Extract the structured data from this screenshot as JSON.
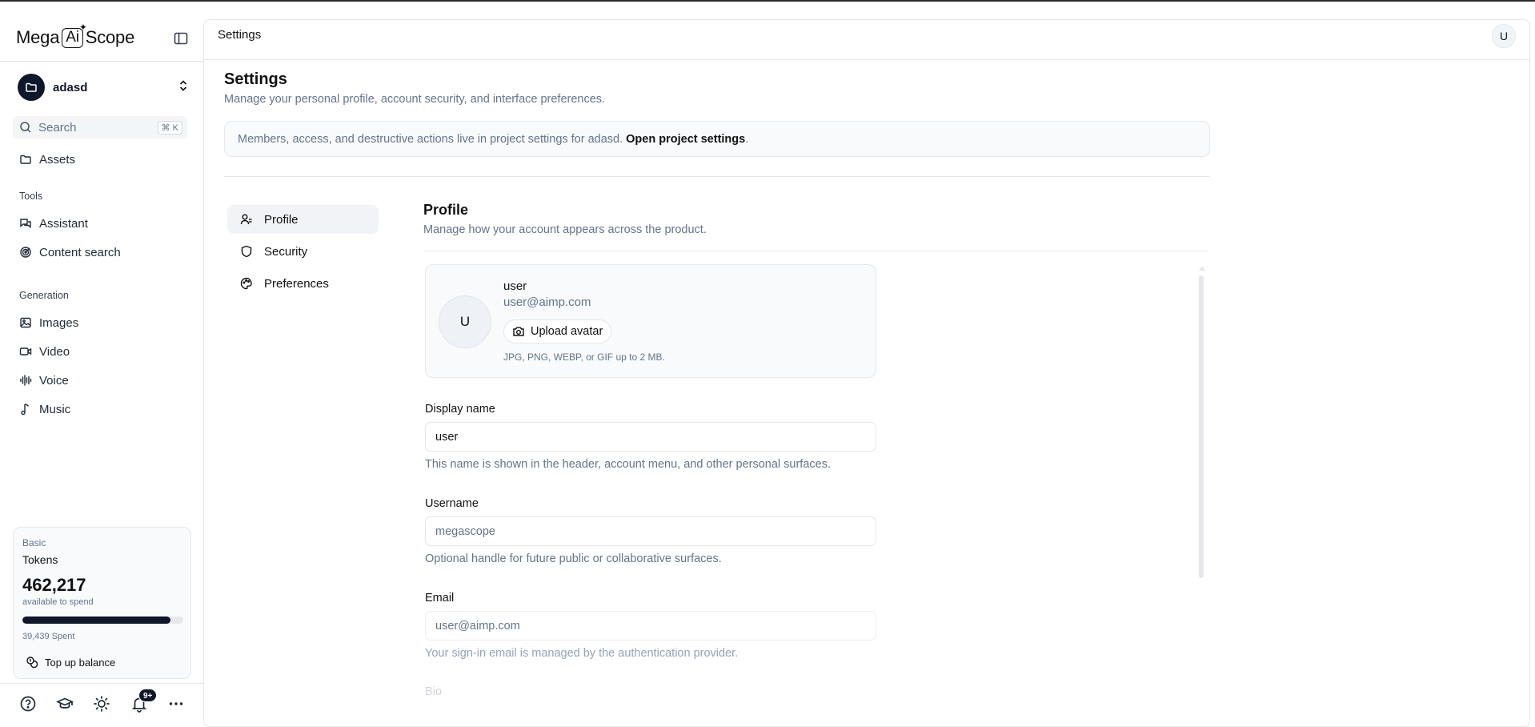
{
  "brand": {
    "left": "Mega",
    "mid": "Ai",
    "right": "Scope"
  },
  "sidebar": {
    "project_name": "adasd",
    "search_placeholder": "Search",
    "search_shortcut": "⌘ K",
    "assets_label": "Assets",
    "tools_label": "Tools",
    "tools": [
      {
        "label": "Assistant",
        "icon": "chat-icon"
      },
      {
        "label": "Content search",
        "icon": "radar-icon"
      }
    ],
    "generation_label": "Generation",
    "generation": [
      {
        "label": "Images",
        "icon": "image-icon"
      },
      {
        "label": "Video",
        "icon": "video-icon"
      },
      {
        "label": "Voice",
        "icon": "audio-wave-icon"
      },
      {
        "label": "Music",
        "icon": "music-note-icon"
      }
    ],
    "tokens": {
      "plan": "Basic",
      "label": "Tokens",
      "value": "462,217",
      "available": "available to spend",
      "spent": "39,439 Spent",
      "spent_fraction": 0.92,
      "topup": "Top up balance"
    },
    "notification_badge": "9+"
  },
  "topbar": {
    "title": "Settings",
    "avatar_initial": "U"
  },
  "page": {
    "title": "Settings",
    "subtitle": "Manage your personal profile, account security, and interface preferences.",
    "banner_text": "Members, access, and destructive actions live in project settings for adasd.",
    "banner_link": "Open project settings",
    "banner_end": "."
  },
  "tabs": [
    {
      "label": "Profile",
      "icon": "user-icon",
      "active": true
    },
    {
      "label": "Security",
      "icon": "shield-icon",
      "active": false
    },
    {
      "label": "Preferences",
      "icon": "palette-icon",
      "active": false
    }
  ],
  "profile": {
    "title": "Profile",
    "subtitle": "Manage how your account appears across the product.",
    "avatar_initial": "U",
    "name": "user",
    "email": "user@aimp.com",
    "upload_label": "Upload avatar",
    "upload_hint": "JPG, PNG, WEBP, or GIF up to 2 MB.",
    "display_name_label": "Display name",
    "display_name_value": "user",
    "display_name_help": "This name is shown in the header, account menu, and other personal surfaces.",
    "username_label": "Username",
    "username_placeholder": "megascope",
    "username_help": "Optional handle for future public or collaborative surfaces.",
    "email_label": "Email",
    "email_placeholder": "user@aimp.com",
    "email_help": "Your sign-in email is managed by the authentication provider.",
    "bio_label": "Bio"
  },
  "colors": {
    "primary": "#0f172a",
    "muted": "#64748b",
    "border": "#e5e7eb"
  }
}
